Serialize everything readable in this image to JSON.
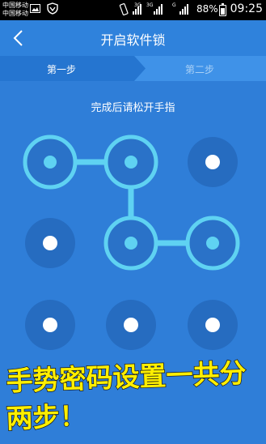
{
  "status_bar": {
    "carrier_1": "中国移动",
    "carrier_2": "中国移动",
    "net_1": "3G",
    "net_2": "3G",
    "net_3": "G",
    "battery": "88%",
    "time": "09:25"
  },
  "header": {
    "title": "开启软件锁",
    "back_icon": "chevron-left-icon"
  },
  "steps": {
    "step_1": "第一步",
    "step_2": "第二步",
    "active_step": 1
  },
  "instruction": "完成后请松开手指",
  "pattern": {
    "rows": 3,
    "cols": 3,
    "selected_sequence": [
      1,
      2,
      5,
      6
    ]
  },
  "caption": {
    "line_1": "手势密码设置一共分",
    "line_2": "两步！"
  },
  "colors": {
    "background": "#2f7ed8",
    "active_line": "#5fd2f2",
    "dot": "#ffffff",
    "caption_fill": "#ffef00"
  }
}
